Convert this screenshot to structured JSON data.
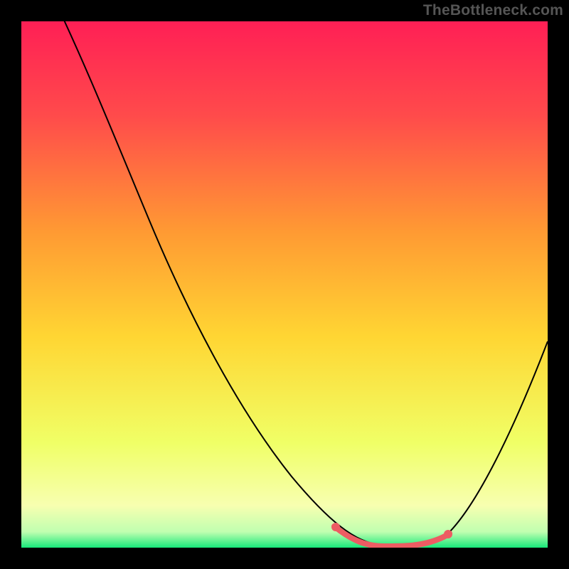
{
  "watermark": "TheBottleneck.com",
  "colors": {
    "gradient_top": "#ff1f55",
    "gradient_mid": "#ffd633",
    "gradient_low": "#f7ffb0",
    "gradient_bottom": "#17e87a",
    "curve": "#000000",
    "highlight": "#ed5c63",
    "background": "#000000"
  },
  "chart_data": {
    "type": "line",
    "title": "",
    "xlabel": "",
    "ylabel": "",
    "xlim": [
      0,
      100
    ],
    "ylim": [
      0,
      100
    ],
    "series": [
      {
        "name": "bottleneck-curve",
        "x": [
          0,
          6,
          12,
          18,
          24,
          30,
          36,
          42,
          48,
          54,
          60,
          64,
          68,
          72,
          76,
          80,
          84,
          88,
          92,
          96,
          100
        ],
        "values": [
          120,
          100,
          88,
          77,
          66,
          55,
          45,
          36,
          28,
          20,
          13,
          8,
          4,
          1,
          0,
          1,
          6,
          15,
          28,
          42,
          57
        ]
      }
    ],
    "highlight_segment": {
      "series": "bottleneck-curve",
      "x_range": [
        62,
        80
      ],
      "values": [
        9,
        6,
        3,
        1,
        0,
        0,
        0,
        1,
        3
      ]
    },
    "annotations": []
  }
}
